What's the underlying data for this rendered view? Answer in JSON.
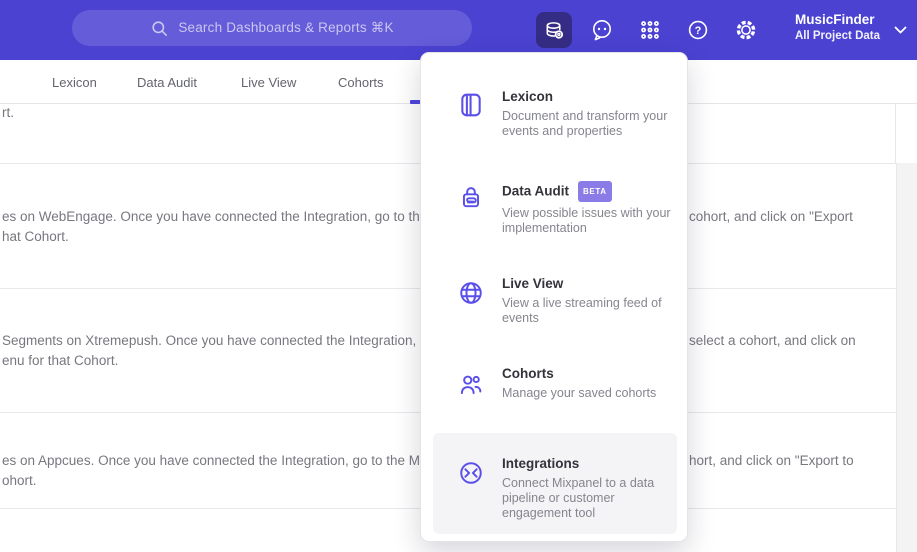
{
  "header": {
    "search_placeholder": "Search Dashboards & Reports ⌘K",
    "project_name": "MusicFinder",
    "project_scope": "All Project Data",
    "icons": [
      "database-gear-icon",
      "feedback-chat-icon",
      "apps-grid-icon",
      "help-icon",
      "gear-icon",
      "chevron-down-icon"
    ]
  },
  "navbar": {
    "tabs": [
      "Lexicon",
      "Data Audit",
      "Live View",
      "Cohorts"
    ]
  },
  "content_rows": {
    "row0_l1": "rt.",
    "we_l1a": "es on WebEngage. Once you have connected the Integration, go to the",
    "we_l1b": "cohort, and click on \"Export",
    "we_l2": "hat Cohort.",
    "xp_l1a": "Segments on Xtremepush. Once you have connected the Integration,",
    "xp_l1b": "select a cohort, and click on",
    "xp_l2": "enu for that Cohort.",
    "ac_l1a": "es on Appcues. Once you have connected the Integration, go to the M",
    "ac_l1b": "hort, and click on \"Export to",
    "ac_l2": "ohort."
  },
  "menu": {
    "items": [
      {
        "title": "Lexicon",
        "icon": "book-icon",
        "desc": "Document and transform your events and properties"
      },
      {
        "title": "Data Audit",
        "icon": "lock-audit-icon",
        "badge": "BETA",
        "desc": "View possible issues with your implementation"
      },
      {
        "title": "Live View",
        "icon": "globe-icon",
        "desc": "View a live streaming feed of events"
      },
      {
        "title": "Cohorts",
        "icon": "people-icon",
        "desc": "Manage your saved cohorts"
      },
      {
        "title": "Integrations",
        "icon": "sync-arrows-icon",
        "desc": "Connect Mixpanel to a data pipeline or customer engagement tool",
        "highlighted": true
      }
    ]
  },
  "colors": {
    "header_bg": "#4b42d2",
    "active_button_bg": "#352d85",
    "accent_purple": "#4f44e0",
    "menu_icon_purple": "#5a4fe8",
    "beta_badge_bg": "#8a7ce6",
    "desc_gray": "#85858e",
    "row_text_gray": "#77777f",
    "page_gray": "#f3f3f4"
  }
}
